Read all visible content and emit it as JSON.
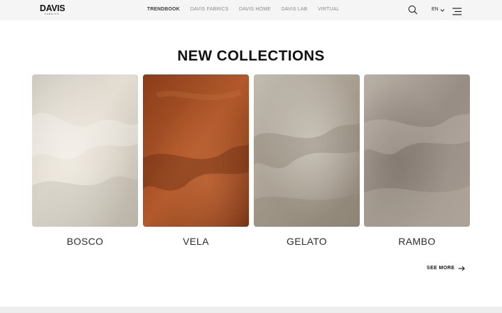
{
  "brand": {
    "name": "DAVIS",
    "sub": "FABRICS"
  },
  "nav": {
    "items": [
      {
        "label": "TRENDBOOK",
        "active": true
      },
      {
        "label": "DAVIS FABRICS",
        "active": false
      },
      {
        "label": "DAVIS HOME",
        "active": false
      },
      {
        "label": "DAVIS LAB",
        "active": false
      },
      {
        "label": "VIRTUAL",
        "active": false
      }
    ]
  },
  "header": {
    "search_icon": "search-icon",
    "language": "EN",
    "language_icon": "chevron-down-icon",
    "menu_icon": "hamburger-menu-icon"
  },
  "collections": {
    "title": "NEW COLLECTIONS",
    "items": [
      {
        "name": "BOSCO",
        "color": "#d8d3c8"
      },
      {
        "name": "VELA",
        "color": "#9c4a22"
      },
      {
        "name": "GELATO",
        "color": "#aea597"
      },
      {
        "name": "RAMBO",
        "color": "#9b918a"
      }
    ],
    "see_more": "SEE MORE",
    "see_more_icon": "arrow-right-icon"
  },
  "colors": {
    "topbar_bg": "#f5f5f5",
    "text_primary": "#111111",
    "nav_inactive": "#8a8a8a",
    "footer_band": "#ededed"
  }
}
